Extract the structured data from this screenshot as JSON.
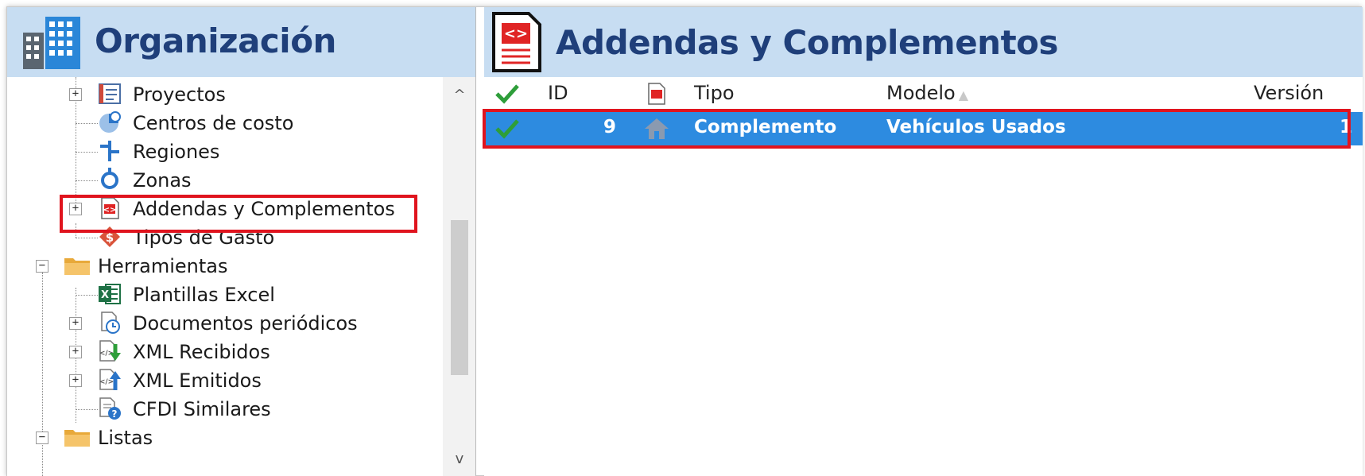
{
  "left_panel": {
    "title": "Organización",
    "tree": [
      {
        "label": "Proyectos",
        "icon": "projects-icon",
        "expander": "+"
      },
      {
        "label": "Centros de costo",
        "icon": "cost-center-icon"
      },
      {
        "label": "Regiones",
        "icon": "regions-icon"
      },
      {
        "label": "Zonas",
        "icon": "zones-icon"
      },
      {
        "label": "Addendas y Complementos",
        "icon": "addenda-icon",
        "expander": "+",
        "highlighted": true
      },
      {
        "label": "Tipos de Gasto",
        "icon": "expense-type-icon"
      },
      {
        "label": "Herramientas",
        "icon": "folder-icon",
        "expander": "−"
      },
      {
        "label": "Plantillas Excel",
        "icon": "excel-icon"
      },
      {
        "label": "Documentos periódicos",
        "icon": "periodic-docs-icon",
        "expander": "+"
      },
      {
        "label": "XML Recibidos",
        "icon": "xml-received-icon",
        "expander": "+"
      },
      {
        "label": "XML Emitidos",
        "icon": "xml-issued-icon",
        "expander": "+"
      },
      {
        "label": "CFDI Similares",
        "icon": "cfdi-similar-icon"
      },
      {
        "label": "Listas",
        "icon": "folder-icon",
        "expander": "−"
      }
    ],
    "scroll_up_glyph": "^",
    "scroll_down_glyph": "v"
  },
  "right_panel": {
    "title": "Addendas y Complementos",
    "columns": {
      "id": "ID",
      "tipo": "Tipo",
      "modelo": "Modelo",
      "version": "Versión"
    },
    "rows": [
      {
        "id": "9",
        "tipo": "Complemento",
        "modelo": "Vehículos Usados",
        "version": "1",
        "selected": true
      }
    ]
  },
  "colors": {
    "header_bg": "#c7ddf2",
    "header_text": "#1f3f7a",
    "selection": "#2d8be0",
    "highlight_box": "#e0141e"
  }
}
